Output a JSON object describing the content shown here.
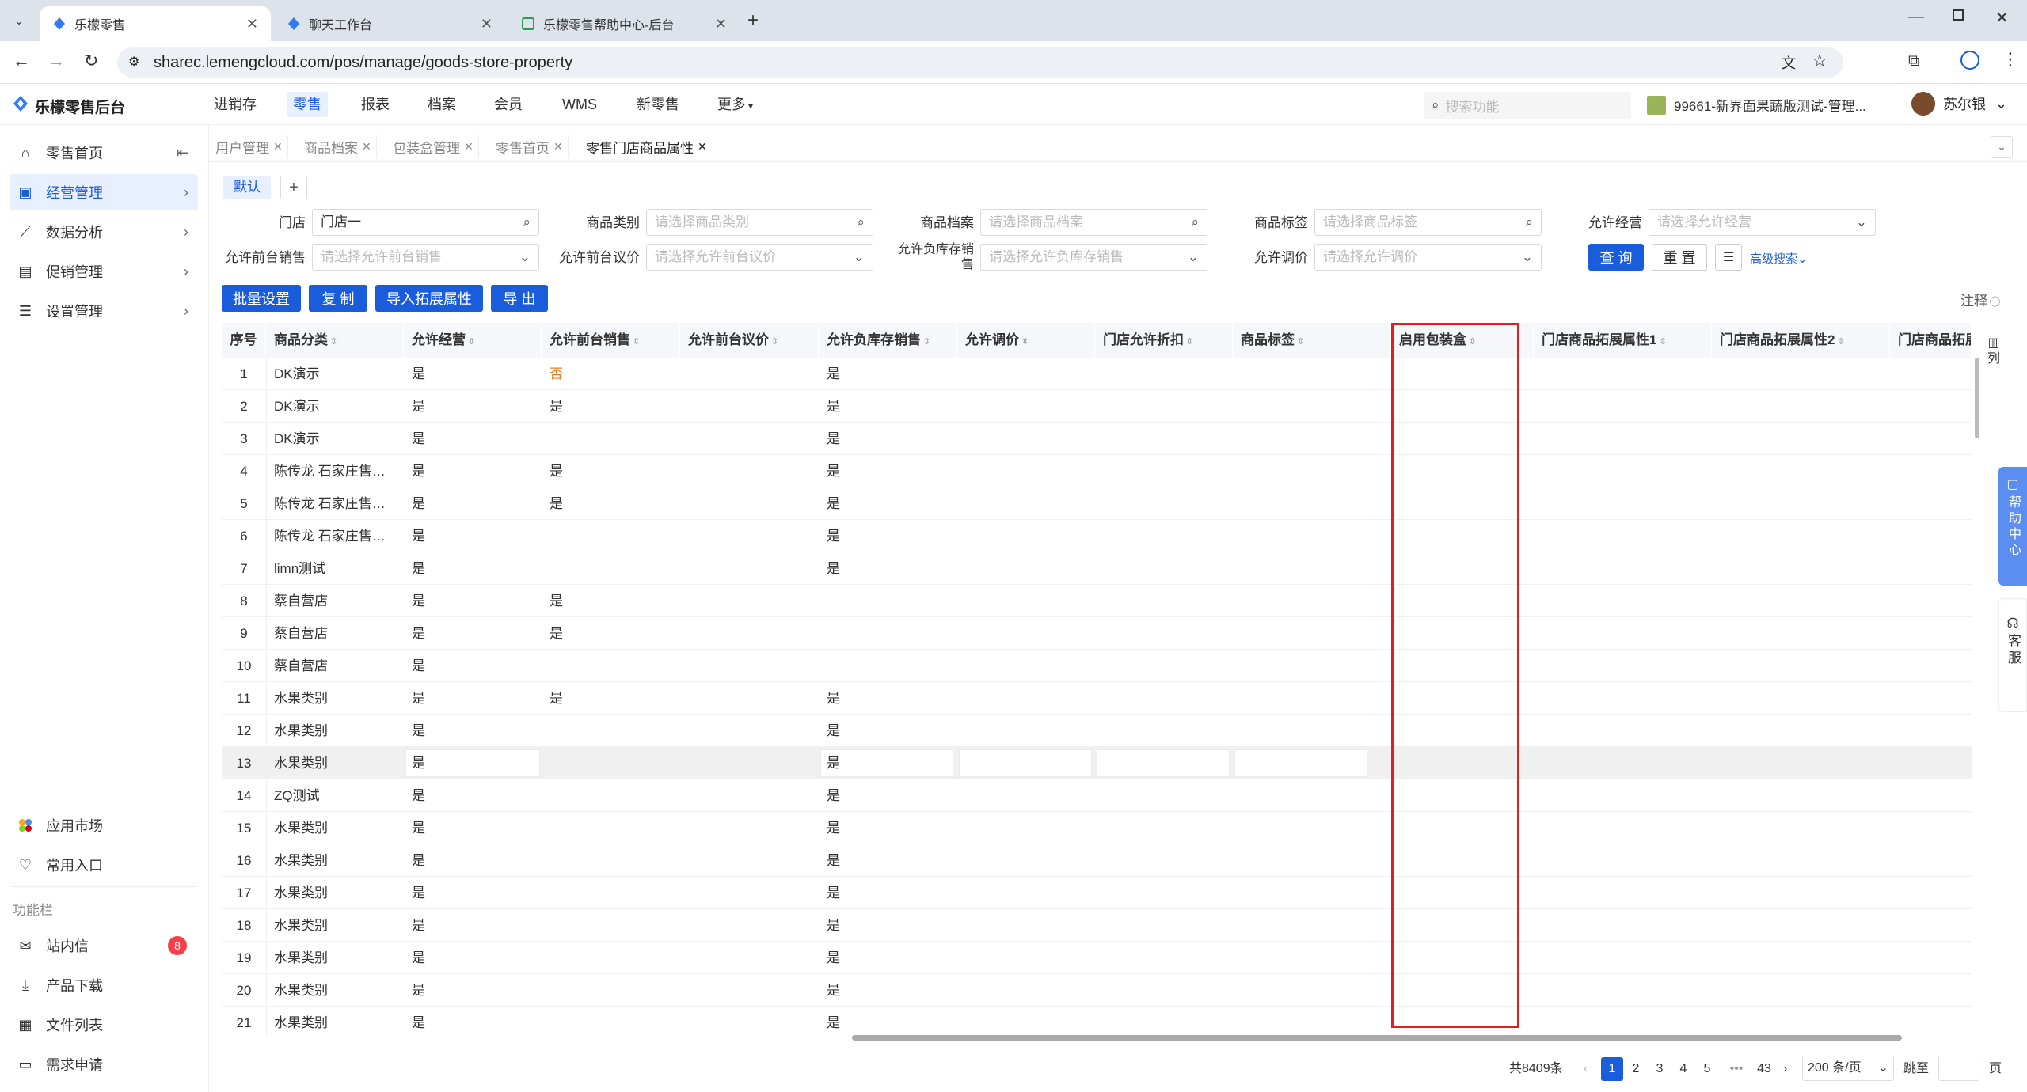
{
  "browser": {
    "tabs": [
      {
        "title": "乐檬零售",
        "active": true
      },
      {
        "title": "聊天工作台",
        "active": false
      },
      {
        "title": "乐檬零售帮助中心-后台",
        "active": false
      }
    ],
    "url": "sharec.lemengcloud.com/pos/manage/goods-store-property"
  },
  "app": {
    "brand": "乐檬零售后台",
    "nav": [
      "进销存",
      "零售",
      "报表",
      "档案",
      "会员",
      "WMS",
      "新零售",
      "更多"
    ],
    "active_nav": "零售",
    "search_placeholder": "搜索功能",
    "store": "99661-新界面果蔬版测试-管理...",
    "user": "苏尔银"
  },
  "sidebar": {
    "items": [
      "零售首页",
      "经营管理",
      "数据分析",
      "促销管理",
      "设置管理"
    ],
    "bottom": [
      "应用市场",
      "常用入口"
    ],
    "section_label": "功能栏",
    "func_items": [
      "站内信",
      "产品下载",
      "文件列表",
      "需求申请"
    ],
    "inbox_count": "8"
  },
  "page_tabs": [
    "用户管理",
    "商品档案",
    "包装盒管理",
    "零售首页",
    "零售门店商品属性"
  ],
  "scheme": {
    "default": "默认",
    "add": "+"
  },
  "filters": {
    "store_label": "门店",
    "store_value": "门店一",
    "category_label": "商品类别",
    "category_placeholder": "请选择商品类别",
    "goods_label": "商品档案",
    "goods_placeholder": "请选择商品档案",
    "tag_label": "商品标签",
    "tag_placeholder": "请选择商品标签",
    "allow_op_label": "允许经营",
    "allow_op_placeholder": "请选择允许经营",
    "front_sale_label": "允许前台销售",
    "front_sale_placeholder": "请选择允许前台销售",
    "front_bargain_label": "允许前台议价",
    "front_bargain_placeholder": "请选择允许前台议价",
    "neg_stock_label": "允许负库存销售",
    "neg_stock_placeholder": "请选择允许负库存销售",
    "adjust_label": "允许调价",
    "adjust_placeholder": "请选择允许调价",
    "query": "查 询",
    "reset": "重 置",
    "advanced": "高级搜索"
  },
  "actions": [
    "批量设置",
    "复 制",
    "导入拓展属性",
    "导 出"
  ],
  "note": "注释",
  "table": {
    "columns": [
      "序号",
      "商品分类",
      "允许经营",
      "允许前台销售",
      "允许前台议价",
      "允许负库存销售",
      "允许调价",
      "门店允许折扣",
      "商品标签",
      "启用包装盒",
      "门店商品拓展属性1",
      "门店商品拓展属性2",
      "门店商品拓展属"
    ],
    "rows": [
      [
        "1",
        "DK演示",
        "是",
        "否",
        "",
        "是"
      ],
      [
        "2",
        "DK演示",
        "是",
        "是",
        "",
        "是"
      ],
      [
        "3",
        "DK演示",
        "是",
        "",
        "",
        "是"
      ],
      [
        "4",
        "陈传龙 石家庄售…",
        "是",
        "是",
        "",
        "是"
      ],
      [
        "5",
        "陈传龙 石家庄售…",
        "是",
        "是",
        "",
        "是"
      ],
      [
        "6",
        "陈传龙 石家庄售…",
        "是",
        "",
        "",
        "是"
      ],
      [
        "7",
        "limn测试",
        "是",
        "",
        "",
        "是"
      ],
      [
        "8",
        "蔡自营店",
        "是",
        "是",
        "",
        ""
      ],
      [
        "9",
        "蔡自营店",
        "是",
        "是",
        "",
        ""
      ],
      [
        "10",
        "蔡自营店",
        "是",
        "",
        "",
        ""
      ],
      [
        "11",
        "水果类别",
        "是",
        "是",
        "",
        "是"
      ],
      [
        "12",
        "水果类别",
        "是",
        "",
        "",
        "是"
      ],
      [
        "13",
        "水果类别",
        "是",
        "",
        "",
        "是"
      ],
      [
        "14",
        "ZQ测试",
        "是",
        "",
        "",
        "是"
      ],
      [
        "15",
        "水果类别",
        "是",
        "",
        "",
        "是"
      ],
      [
        "16",
        "水果类别",
        "是",
        "",
        "",
        "是"
      ],
      [
        "17",
        "水果类别",
        "是",
        "",
        "",
        "是"
      ],
      [
        "18",
        "水果类别",
        "是",
        "",
        "",
        "是"
      ],
      [
        "19",
        "水果类别",
        "是",
        "",
        "",
        "是"
      ],
      [
        "20",
        "水果类别",
        "是",
        "",
        "",
        "是"
      ],
      [
        "21",
        "水果类别",
        "是",
        "",
        "",
        "是"
      ]
    ],
    "column_setting": "列"
  },
  "pager": {
    "total": "共8409条",
    "pages": [
      "1",
      "2",
      "3",
      "4",
      "5",
      "•••",
      "43"
    ],
    "per_page": "200 条/页",
    "jump": "跳至",
    "page_unit": "页"
  },
  "float": {
    "help": "帮助中心",
    "service": "客服"
  },
  "colors": {
    "primary": "#1a5ddc",
    "highlight_box": "#e02020",
    "no_value": "#f07a22"
  }
}
